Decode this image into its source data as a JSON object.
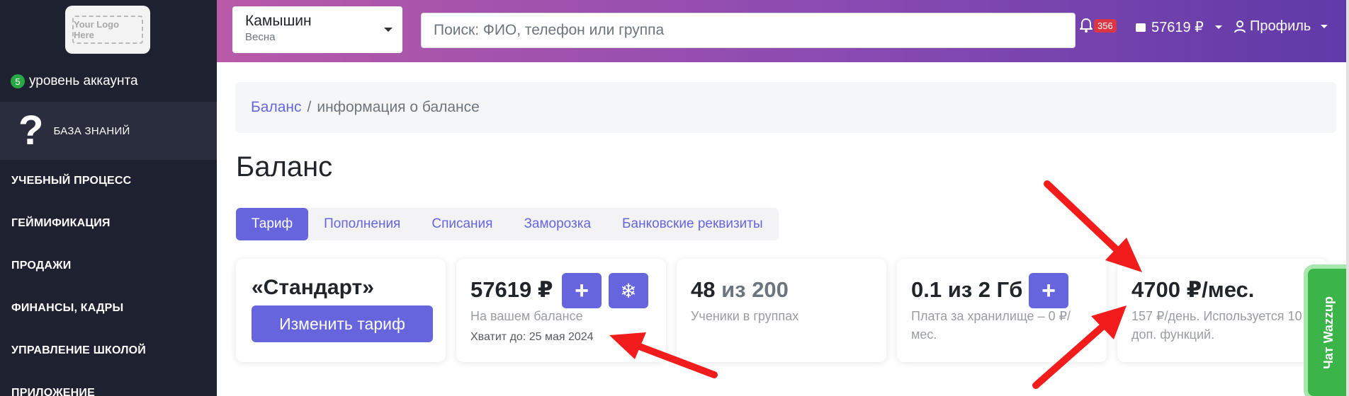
{
  "sidebar": {
    "logo_text": "Your Logo Here",
    "level_number": "5",
    "level_label": "уровень аккаунта",
    "knowledge_icon": "?",
    "knowledge_label": "БАЗА ЗНАНИЙ",
    "items": [
      {
        "label": "УЧЕБНЫЙ ПРОЦЕСС"
      },
      {
        "label": "ГЕЙМИФИКАЦИЯ"
      },
      {
        "label": "ПРОДАЖИ"
      },
      {
        "label": "ФИНАНСЫ, КАДРЫ"
      },
      {
        "label": "УПРАВЛЕНИЕ ШКОЛОЙ"
      },
      {
        "label": "ПРИЛОЖЕНИЕ"
      }
    ]
  },
  "topbar": {
    "school_name": "Камышин",
    "school_season": "Весна",
    "search_placeholder": "Поиск: ФИО, телефон или группа",
    "notifications_count": "356",
    "balance": "57619 ₽",
    "profile_label": "Профиль"
  },
  "breadcrumb": {
    "link": "Баланс",
    "separator": "/",
    "current": "информация о балансе"
  },
  "page": {
    "title": "Баланс",
    "tabs": [
      {
        "label": "Тариф",
        "active": true
      },
      {
        "label": "Пополнения"
      },
      {
        "label": "Списания"
      },
      {
        "label": "Заморозка"
      },
      {
        "label": "Банковские реквизиты"
      }
    ]
  },
  "cards": {
    "plan_name": "«Стандарт»",
    "change_plan_label": "Изменить тариф",
    "balance_value": "57619 ₽",
    "balance_label": "На вашем балансе",
    "balance_until": "Хватит до: 25 мая 2024",
    "add_icon": "+",
    "freeze_icon": "❄",
    "students_count": "48",
    "students_total": "из 200",
    "students_label": "Ученики в группах",
    "storage_value": "0.1 из 2 Гб",
    "storage_label": "Плата за хранилище – 0 ₽/мес.",
    "monthly_value": "4700 ₽/мес.",
    "monthly_label": "157 ₽/день. Используется 10 доп. функций."
  },
  "chat": {
    "label": "Чат Wazzup"
  },
  "colors": {
    "accent": "#6665dd",
    "sidebar": "#1e2130",
    "annotation": "#f21c1c",
    "chat": "#3bb54a"
  }
}
